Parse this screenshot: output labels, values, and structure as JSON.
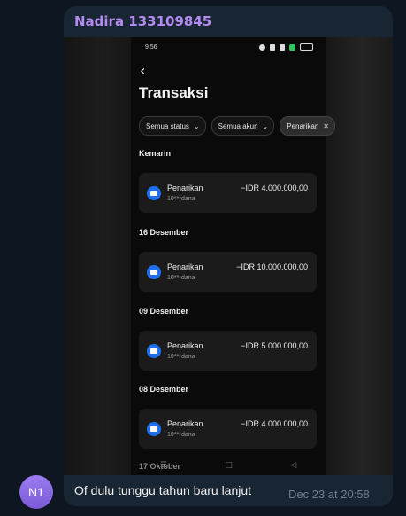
{
  "message": {
    "sender": "Nadira 133109845",
    "avatar_initials": "N1",
    "caption": "Of dulu tunggu tahun baru lanjut",
    "timestamp": "Dec 23 at 20:58"
  },
  "phone": {
    "status_time": "9.56",
    "back_icon": "back-arrow-icon",
    "title": "Transaksi",
    "filters": [
      {
        "label": "Semua status",
        "icon": "chevron-down-icon"
      },
      {
        "label": "Semua akun",
        "icon": "chevron-down-icon"
      },
      {
        "label": "Penarikan",
        "icon": "close-icon"
      }
    ],
    "groups": [
      {
        "date": "Kemarin",
        "label": "Penarikan",
        "account": "10***dana",
        "amount": "−IDR 4.000.000,00"
      },
      {
        "date": "16 Desember",
        "label": "Penarikan",
        "account": "10***dana",
        "amount": "−IDR 10.000.000,00"
      },
      {
        "date": "09 Desember",
        "label": "Penarikan",
        "account": "10***dana",
        "amount": "−IDR 5.000.000,00"
      },
      {
        "date": "08 Desember",
        "label": "Penarikan",
        "account": "10***dana",
        "amount": "−IDR 4.000.000,00"
      },
      {
        "date": "17 Oktober"
      }
    ],
    "nav": [
      "menu-icon",
      "home-icon",
      "back-triangle-icon"
    ]
  }
}
